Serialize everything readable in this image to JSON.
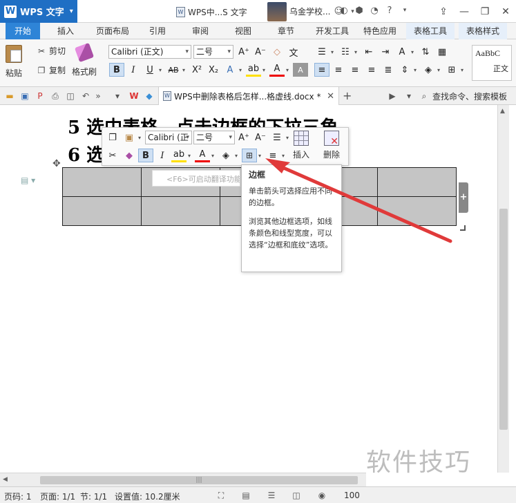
{
  "app": {
    "brand": "WPS 文字",
    "logo_letter": "W",
    "window_title": "WPS中...S 文字",
    "user_name": "乌金学校..."
  },
  "ribbon_tabs": [
    "开始",
    "插入",
    "页面布局",
    "引用",
    "审阅",
    "视图",
    "章节",
    "开发工具",
    "特色应用",
    "表格工具",
    "表格样式"
  ],
  "active_tab": "开始",
  "ribbon": {
    "paste": "粘贴",
    "cut": "剪切",
    "copy": "复制",
    "format_painter": "格式刷",
    "font_name": "Calibri (正文)",
    "font_size": "二号",
    "style_preview_1": "AaBbC",
    "style_preview_2": "正文"
  },
  "doc_tab": {
    "name": "WPS中删除表格后怎样...格虚线.docx *"
  },
  "search_command": "查找命令、搜索模板",
  "document": {
    "line5": "5 选中表格，点击边框的下拉三角。",
    "line6": "6 选",
    "hint": "<F6>可启动翻译功能"
  },
  "mini_toolbar": {
    "font_name": "Calibri (正",
    "font_size": "二号",
    "insert": "插入",
    "delete": "删除"
  },
  "tooltip": {
    "title": "边框",
    "p1": "单击箭头可选择应用不同的边框。",
    "p2": "浏览其他边框选项，如线条颜色和线型宽度，可以选择“边框和底纹”选项。"
  },
  "watermark": "软件技巧",
  "status": {
    "page_num": "页码: 1",
    "page": "页面: 1/1",
    "section": "节: 1/1",
    "setting": "设置值: 10.2厘米",
    "zoom": "100"
  },
  "colors": {
    "accent": "#2e84d7",
    "brand": "#1f6fc4",
    "arrow": "#e03a3a",
    "table_fill": "#c5c5c5"
  }
}
